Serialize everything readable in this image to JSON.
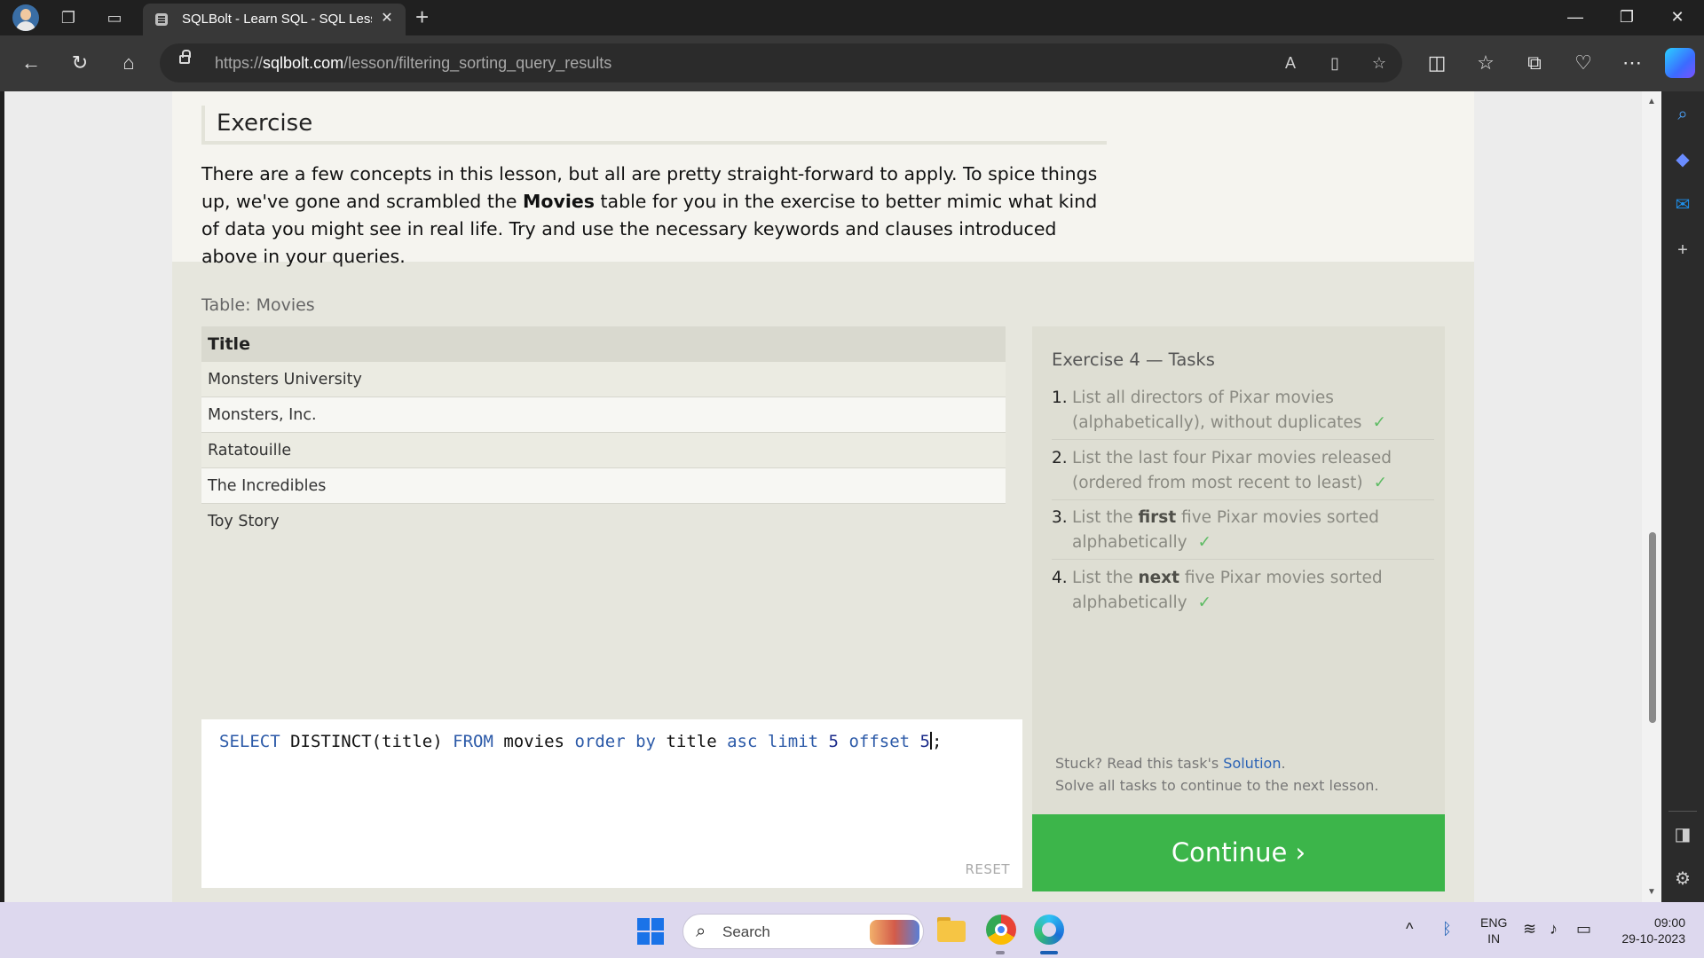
{
  "browser": {
    "tab_title": "SQLBolt - Learn SQL - SQL Lesson",
    "url_scheme": "https://",
    "url_domain": "sqlbolt.com",
    "url_path": "/lesson/filtering_sorting_query_results"
  },
  "exercise": {
    "heading": "Exercise",
    "intro_part1": "There are a few concepts in this lesson, but all are pretty straight-forward to apply. To spice things up, we've gone and scrambled the ",
    "intro_bold": "Movies",
    "intro_part2": " table for you in the exercise to better mimic what kind of data you might see in real life. Try and use the necessary keywords and clauses introduced above in your queries."
  },
  "table": {
    "label": "Table: Movies",
    "header": "Title",
    "rows": [
      "Monsters University",
      "Monsters, Inc.",
      "Ratatouille",
      "The Incredibles",
      "Toy Story"
    ]
  },
  "editor": {
    "tokens": [
      "SELECT",
      "DISTINCT(title)",
      "FROM",
      "movies",
      "order",
      "by",
      "title",
      "asc",
      "limit",
      "5",
      "offset",
      "5",
      ";"
    ],
    "reset_label": "RESET"
  },
  "tasks": {
    "heading": "Exercise 4 — Tasks",
    "items": [
      {
        "num": "1.",
        "pre": "List all directors of Pixar movies (alphabetically), without duplicates",
        "bold": "",
        "post": "",
        "check": "✓"
      },
      {
        "num": "2.",
        "pre": "List the last four Pixar movies released (ordered from most recent to least)",
        "bold": "",
        "post": "",
        "check": "✓"
      },
      {
        "num": "3.",
        "pre": "List the ",
        "bold": "first",
        "post": " five Pixar movies sorted alphabetically",
        "check": "✓"
      },
      {
        "num": "4.",
        "pre": "List the ",
        "bold": "next",
        "post": " five Pixar movies sorted alphabetically",
        "check": "✓"
      }
    ],
    "stuck_pre": "Stuck? Read this task's ",
    "stuck_link": "Solution",
    "stuck_post": ".",
    "solve_note": "Solve all tasks to continue to the next lesson.",
    "continue_label": "Continue ›"
  },
  "taskbar": {
    "search_label": "Search",
    "lang_line1": "ENG",
    "lang_line2": "IN",
    "time": "09:00",
    "date": "29-10-2023"
  },
  "colors": {
    "continue_green": "#3cb54a",
    "check_green": "#5dbb63",
    "keyword_blue": "#2c5aa8",
    "link_blue": "#2a62b5"
  }
}
